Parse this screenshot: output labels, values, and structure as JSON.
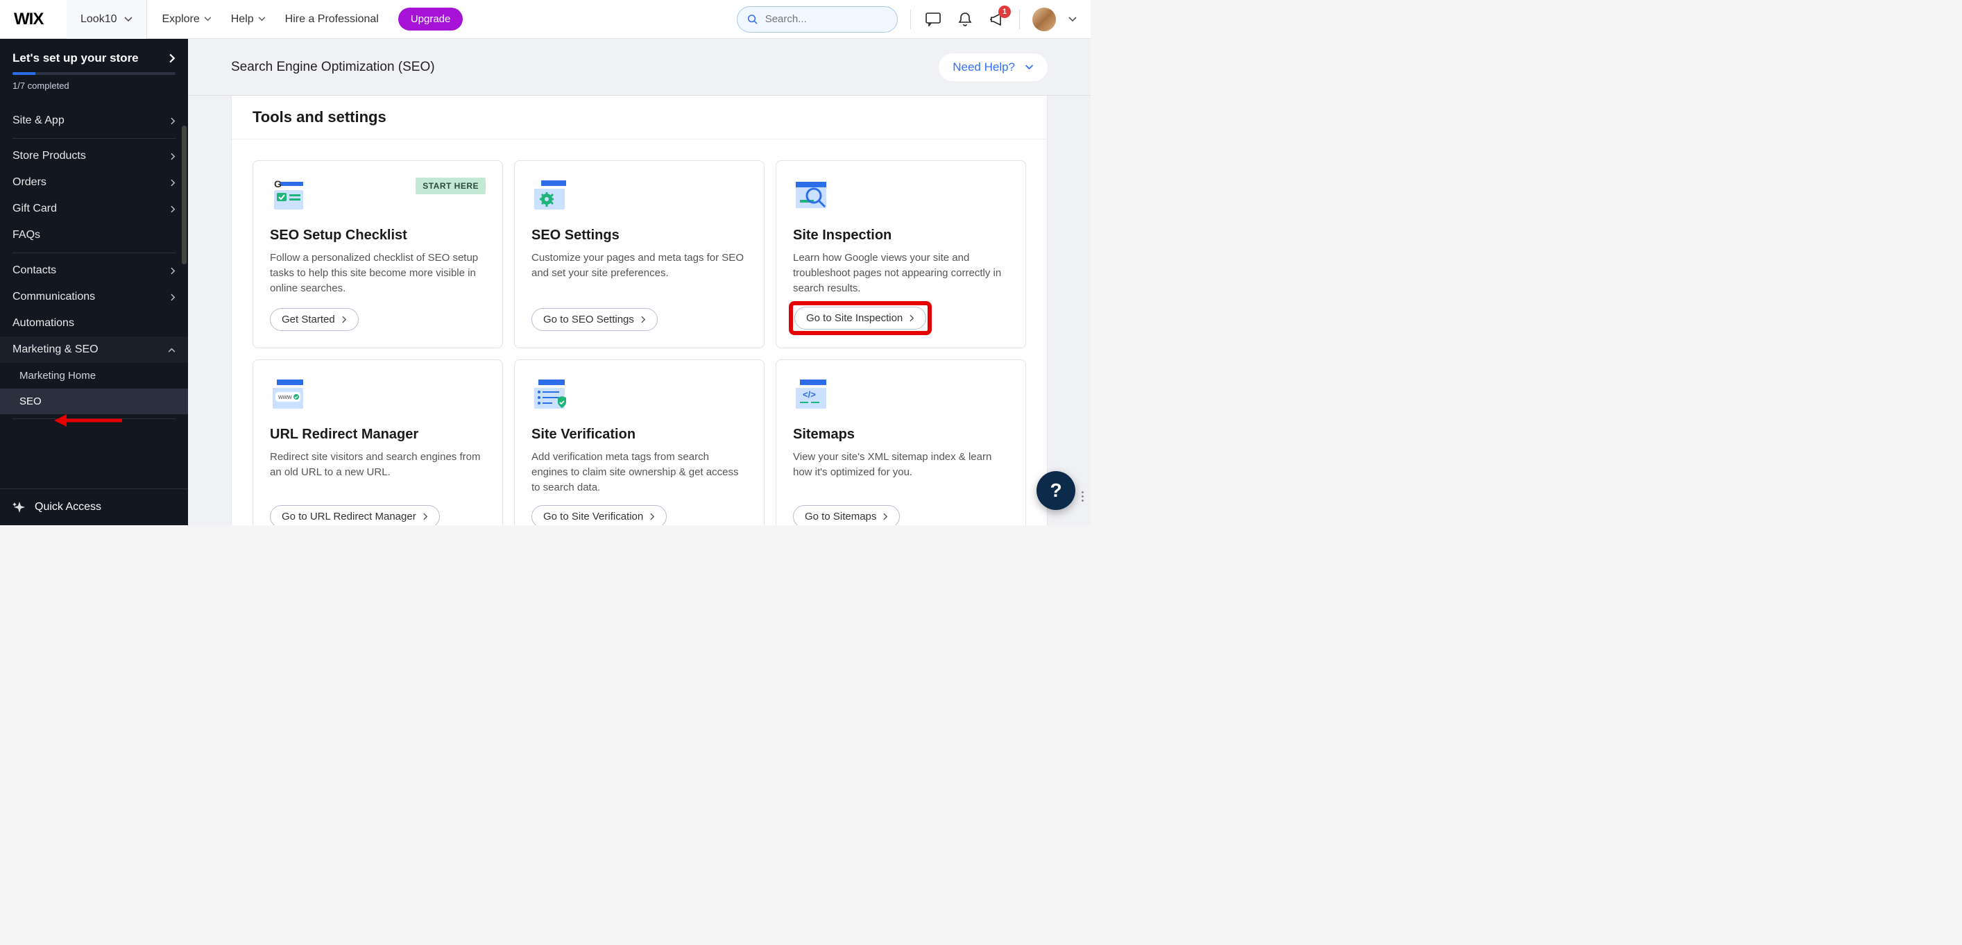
{
  "topbar": {
    "logo": "WIX",
    "site_name": "Look10",
    "nav": {
      "explore": "Explore",
      "help": "Help",
      "hire": "Hire a Professional"
    },
    "upgrade": "Upgrade",
    "search_placeholder": "Search...",
    "notification_count": "1"
  },
  "sidebar": {
    "setup_title": "Let's set up your store",
    "progress_text": "1/7 completed",
    "items": {
      "site_app": "Site & App",
      "store_products": "Store Products",
      "orders": "Orders",
      "gift_card": "Gift Card",
      "faqs": "FAQs",
      "contacts": "Contacts",
      "communications": "Communications",
      "automations": "Automations",
      "marketing_seo": "Marketing & SEO"
    },
    "subitems": {
      "marketing_home": "Marketing Home",
      "seo": "SEO"
    },
    "quick_access": "Quick Access"
  },
  "page": {
    "title": "Search Engine Optimization (SEO)",
    "need_help": "Need Help?",
    "tools_title": "Tools and settings"
  },
  "cards": {
    "start_here": "START HERE",
    "checklist": {
      "title": "SEO Setup Checklist",
      "desc": "Follow a personalized checklist of SEO setup tasks to help this site become more visible in online searches.",
      "btn": "Get Started"
    },
    "settings": {
      "title": "SEO Settings",
      "desc": "Customize your pages and meta tags for SEO and set your site preferences.",
      "btn": "Go to SEO Settings"
    },
    "inspection": {
      "title": "Site Inspection",
      "desc": "Learn how Google views your site and troubleshoot pages not appearing correctly in search results.",
      "btn": "Go to Site Inspection"
    },
    "redirect": {
      "title": "URL Redirect Manager",
      "desc": "Redirect site visitors and search engines from an old URL to a new URL.",
      "btn": "Go to URL Redirect Manager"
    },
    "verification": {
      "title": "Site Verification",
      "desc": "Add verification meta tags from search engines to claim site ownership & get access to search data.",
      "btn": "Go to Site Verification"
    },
    "sitemaps": {
      "title": "Sitemaps",
      "desc": "View your site's XML sitemap index & learn how it's optimized for you.",
      "btn": "Go to Sitemaps"
    }
  }
}
